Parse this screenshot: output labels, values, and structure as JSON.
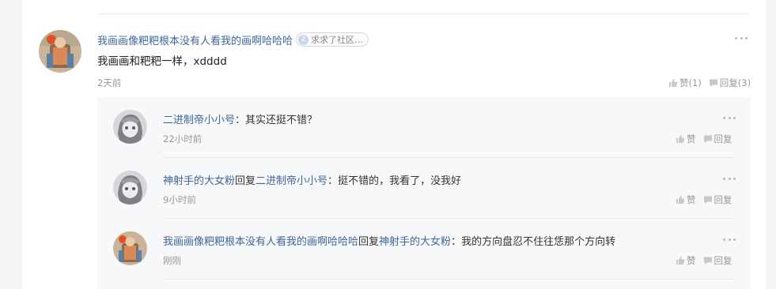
{
  "comment": {
    "author": "我画画像粑粑根本没有人看我的画啊哈哈哈",
    "badge_level": "2",
    "badge_text": "求求了社区…",
    "text": "我画画和粑粑一样，xdddd",
    "time": "2天前",
    "like_label": "赞(1)",
    "reply_label": "回复(3)"
  },
  "replies": [
    {
      "author": "二进制帝小小号",
      "reply_word": "",
      "target": "",
      "separator": "：",
      "text": "其实还挺不错？",
      "time": "22小时前",
      "like_label": "赞",
      "reply_label": "回复"
    },
    {
      "author": "神射手的大女粉",
      "reply_word": "回复",
      "target": "二进制帝小小号",
      "separator": "：",
      "text": "挺不错的，我看了，没我好",
      "time": "9小时前",
      "like_label": "赞",
      "reply_label": "回复"
    },
    {
      "author": "我画画像粑粑根本没有人看我的画啊哈哈哈",
      "reply_word": "回复",
      "target": "神射手的大女粉",
      "separator": "：",
      "text": "我的方向盘忍不住往恁那个方向转",
      "time": "刚刚",
      "like_label": "赞",
      "reply_label": "回复"
    }
  ],
  "colors": {
    "link": "#406599",
    "muted": "#999999",
    "reply_bg": "#f7f8fa"
  },
  "icons": {
    "more": "more-dots-icon",
    "like": "thumbs-up-icon",
    "reply": "comment-bubble-icon"
  }
}
